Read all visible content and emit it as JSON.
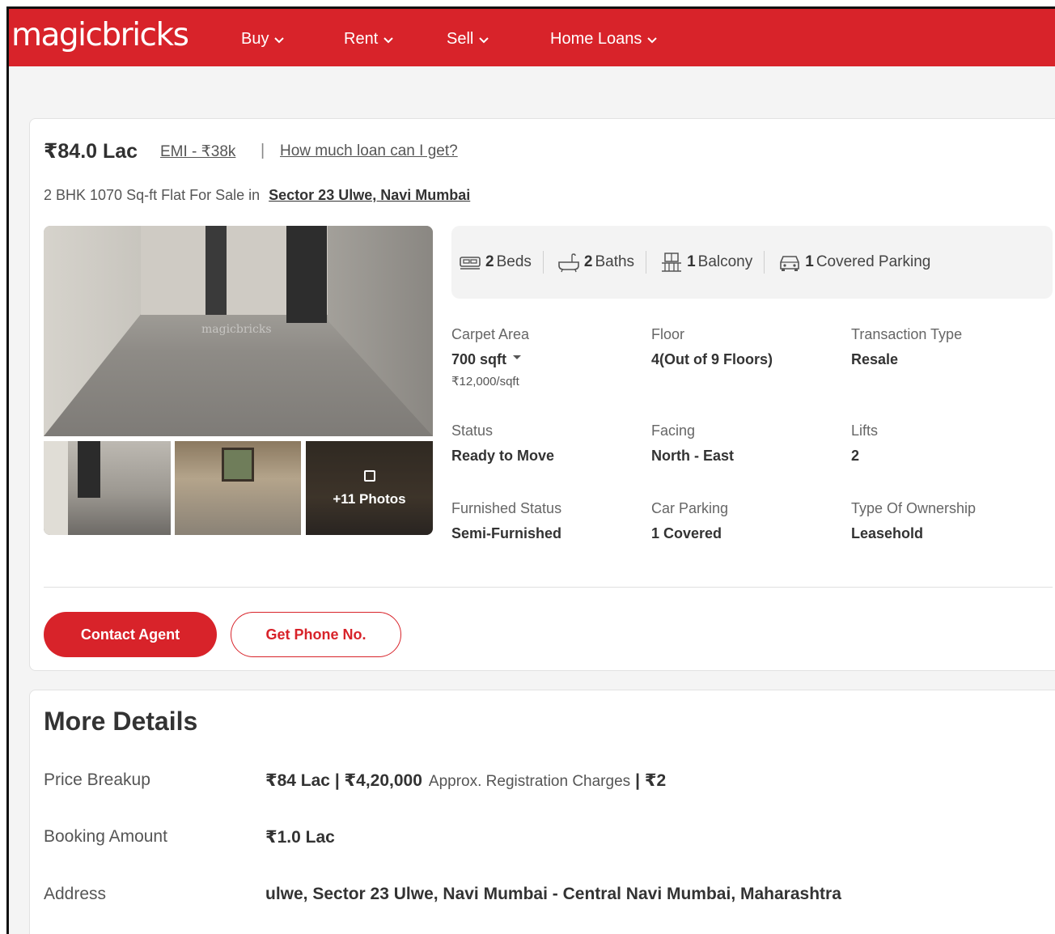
{
  "header": {
    "logo": "magicbricks",
    "nav": [
      {
        "label": "Buy"
      },
      {
        "label": "Rent"
      },
      {
        "label": "Sell"
      },
      {
        "label": "Home Loans"
      }
    ],
    "brand_color": "#d8232a"
  },
  "listing": {
    "price": "₹84.0 Lac",
    "emi": "EMI - ₹38k",
    "separator": "|",
    "loan_link": "How much loan can I get?",
    "subtitle_prefix": "2 BHK 1070 Sq-ft Flat For Sale in",
    "locality": "Sector 23 Ulwe, Navi Mumbai",
    "watermark": "magicbricks",
    "photos_more": "+11 Photos",
    "amenities": [
      {
        "icon": "bed-icon",
        "count": "2",
        "label": "Beds"
      },
      {
        "icon": "bath-icon",
        "count": "2",
        "label": "Baths"
      },
      {
        "icon": "balcony-icon",
        "count": "1",
        "label": "Balcony"
      },
      {
        "icon": "car-icon",
        "count": "1",
        "label": "Covered Parking"
      }
    ],
    "specs": {
      "carpet_area": {
        "label": "Carpet Area",
        "value": "700 sqft",
        "sub": "₹12,000/sqft"
      },
      "floor": {
        "label": "Floor",
        "value": "4(Out of 9 Floors)"
      },
      "transaction": {
        "label": "Transaction Type",
        "value": "Resale"
      },
      "status": {
        "label": "Status",
        "value": "Ready to Move"
      },
      "facing": {
        "label": "Facing",
        "value": "North - East"
      },
      "lifts": {
        "label": "Lifts",
        "value": "2"
      },
      "furnished": {
        "label": "Furnished Status",
        "value": "Semi-Furnished"
      },
      "car_parking": {
        "label": "Car Parking",
        "value": "1 Covered"
      },
      "ownership": {
        "label": "Type Of Ownership",
        "value": "Leasehold"
      }
    },
    "contact_button": "Contact Agent",
    "phone_button": "Get Phone No."
  },
  "more_details": {
    "title": "More Details",
    "rows": [
      {
        "label": "Price Breakup",
        "value_main": "₹84 Lac | ₹4,20,000",
        "value_note": "Approx. Registration Charges",
        "value_tail": "| ₹2"
      },
      {
        "label": "Booking Amount",
        "value_main": "₹1.0 Lac"
      },
      {
        "label": "Address",
        "value_main": "ulwe, Sector 23 Ulwe, Navi Mumbai - Central Navi Mumbai, Maharashtra"
      }
    ]
  }
}
